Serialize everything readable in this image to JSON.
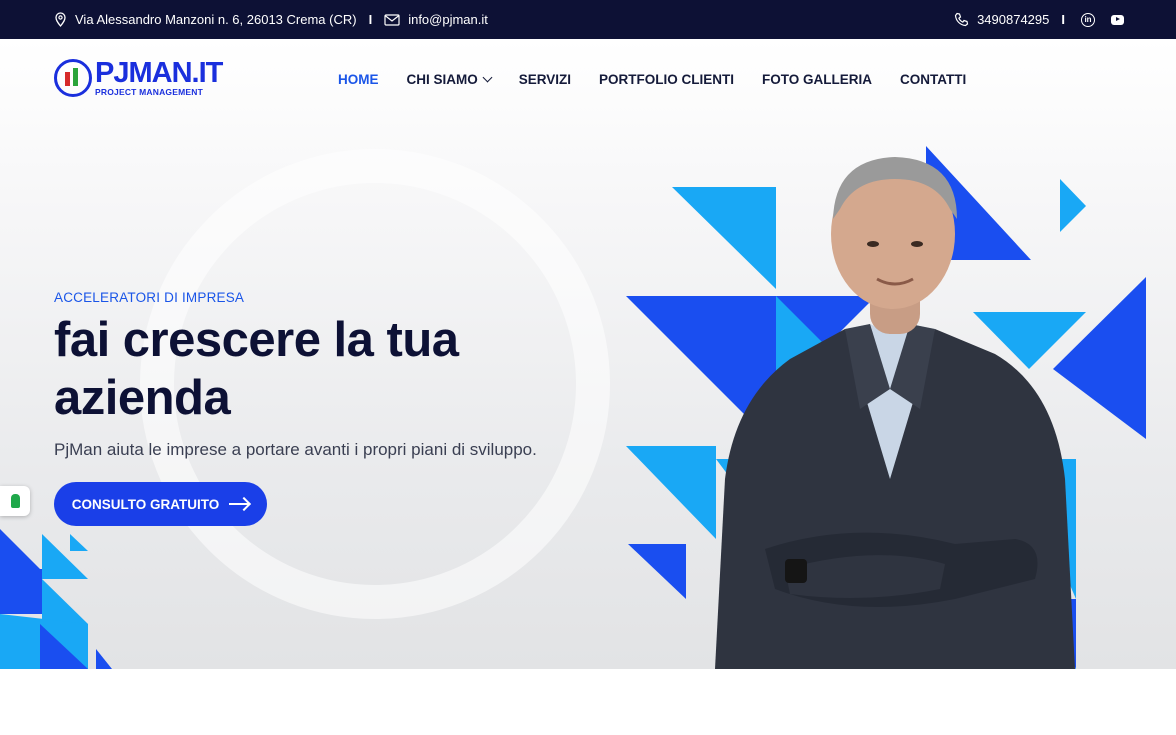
{
  "topbar": {
    "address": "Via Alessandro Manzoni n. 6, 26013 Crema (CR)",
    "separator": "I",
    "email": "info@pjman.it",
    "phone": "3490874295",
    "icons": [
      "location-pin-icon",
      "envelope-icon",
      "phone-icon",
      "linkedin-icon",
      "youtube-icon"
    ]
  },
  "logo": {
    "title": "PJMAN.IT",
    "subtitle": "PROJECT MANAGEMENT"
  },
  "nav": {
    "items": [
      {
        "label": "HOME",
        "active": true
      },
      {
        "label": "CHI SIAMO",
        "dropdown": true
      },
      {
        "label": "SERVIZI"
      },
      {
        "label": "PORTFOLIO CLIENTI"
      },
      {
        "label": "FOTO GALLERIA"
      },
      {
        "label": "CONTATTI"
      }
    ]
  },
  "hero": {
    "eyebrow": "ACCELERATORI DI IMPRESA",
    "headline": "fai crescere la tua azienda",
    "subline": "PjMan aiuta le imprese a portare avanti i propri piani di sviluppo.",
    "cta_label": "CONSULTO GRATUITO"
  },
  "colors": {
    "accent": "#1a55e8",
    "dark": "#0d1135",
    "tri_blue": "#1a4ef0",
    "tri_cyan": "#19a8f5"
  }
}
